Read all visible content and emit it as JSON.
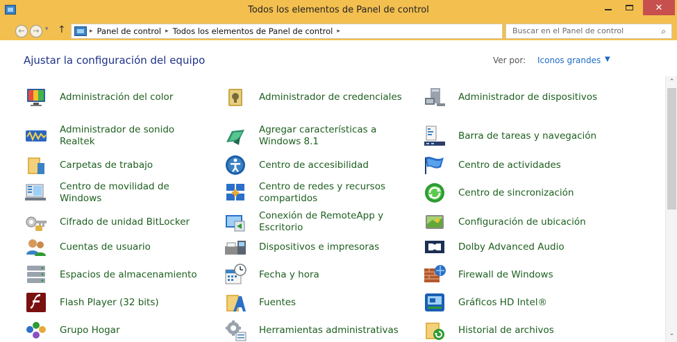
{
  "window": {
    "title": "Todos los elementos de Panel de control",
    "min_glyph": "",
    "close_glyph": "✕"
  },
  "address": {
    "back_glyph": "←",
    "forward_glyph": "→",
    "history_glyph": "▾",
    "up_glyph": "↑",
    "crumbs": [
      "Panel de control",
      "Todos los elementos de Panel de control"
    ],
    "crumb_separator": "▸",
    "dropdown_glyph": "⌄",
    "refresh_glyph": "↻",
    "search_placeholder": "Buscar en el Panel de control",
    "search_glyph": "⌕"
  },
  "header": {
    "title": "Ajustar la configuración del equipo",
    "view_by_label": "Ver por:",
    "view_by_value": "Iconos grandes",
    "view_by_arrow": "▼"
  },
  "items": [
    {
      "label": "Administración del color",
      "icon": "color-management-icon"
    },
    {
      "label": "Administrador de credenciales",
      "icon": "credential-manager-icon"
    },
    {
      "label": "Administrador de dispositivos",
      "icon": "device-manager-icon"
    },
    {
      "label": "Administrador de sonido Realtek",
      "icon": "realtek-audio-icon"
    },
    {
      "label": "Agregar características a Windows 8.1",
      "icon": "add-features-icon"
    },
    {
      "label": "Barra de tareas y navegación",
      "icon": "taskbar-icon"
    },
    {
      "label": "Carpetas de trabajo",
      "icon": "work-folders-icon"
    },
    {
      "label": "Centro de accesibilidad",
      "icon": "ease-of-access-icon"
    },
    {
      "label": "Centro de actividades",
      "icon": "action-center-flag-icon"
    },
    {
      "label": "Centro de movilidad de Windows",
      "icon": "mobility-center-icon"
    },
    {
      "label": "Centro de redes y recursos compartidos",
      "icon": "network-sharing-icon"
    },
    {
      "label": "Centro de sincronización",
      "icon": "sync-center-icon"
    },
    {
      "label": "Cifrado de unidad BitLocker",
      "icon": "bitlocker-key-icon"
    },
    {
      "label": "Conexión de RemoteApp y Escritorio",
      "icon": "remoteapp-icon"
    },
    {
      "label": "Configuración de ubicación",
      "icon": "location-settings-icon"
    },
    {
      "label": "Cuentas de usuario",
      "icon": "user-accounts-icon"
    },
    {
      "label": "Dispositivos e impresoras",
      "icon": "devices-printers-icon"
    },
    {
      "label": "Dolby Advanced Audio",
      "icon": "dolby-icon"
    },
    {
      "label": "Espacios de almacenamiento",
      "icon": "storage-spaces-icon"
    },
    {
      "label": "Fecha y hora",
      "icon": "date-time-icon"
    },
    {
      "label": "Firewall de Windows",
      "icon": "firewall-icon"
    },
    {
      "label": "Flash Player (32 bits)",
      "icon": "flash-player-icon"
    },
    {
      "label": "Fuentes",
      "icon": "fonts-icon"
    },
    {
      "label": "Gráficos HD Intel®",
      "icon": "intel-graphics-icon"
    },
    {
      "label": "Grupo Hogar",
      "icon": "homegroup-icon"
    },
    {
      "label": "Herramientas administrativas",
      "icon": "admin-tools-icon"
    },
    {
      "label": "Historial de archivos",
      "icon": "file-history-icon"
    }
  ],
  "scrollbar": {
    "up_glyph": "⌃",
    "down_glyph": "⌄",
    "visible_fraction": 0.45,
    "position_fraction": 0
  },
  "colors": {
    "titlebar": "#f3bf4f",
    "link_green": "#1c5e1e",
    "header_blue": "#1e3287",
    "close_red": "#c7504f"
  }
}
